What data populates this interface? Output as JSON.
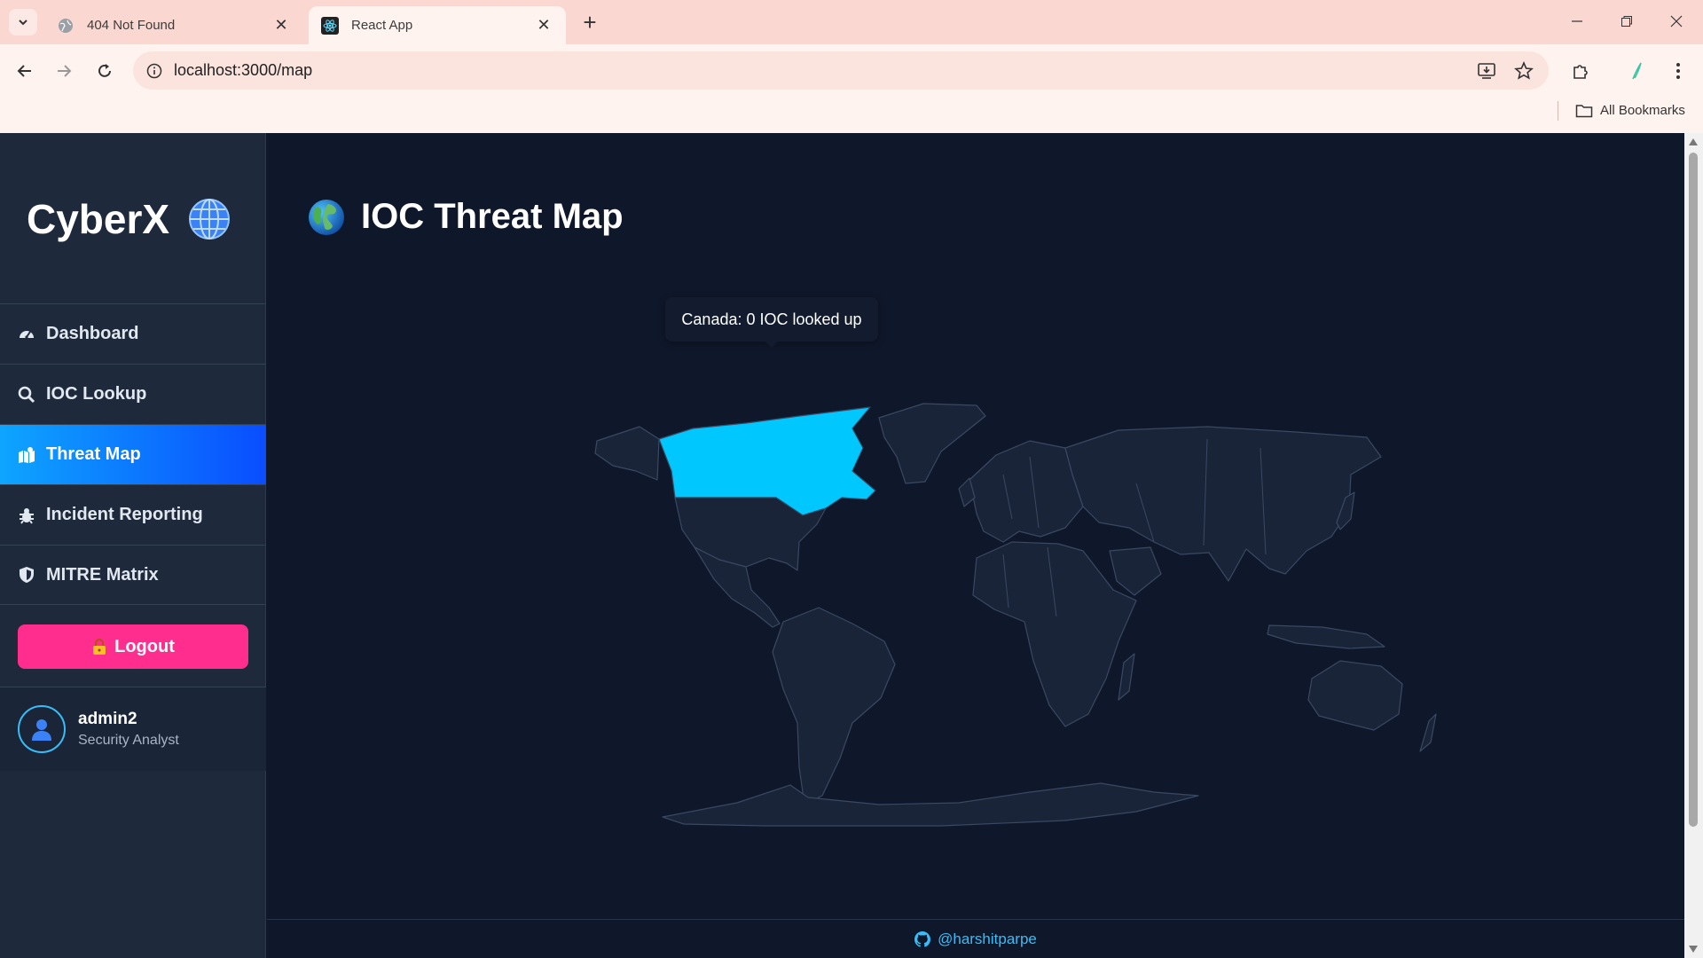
{
  "browser": {
    "tabs": [
      {
        "title": "404 Not Found",
        "active": false
      },
      {
        "title": "React App",
        "active": true
      }
    ],
    "url": "localhost:3000/map",
    "bookmarks_label": "All Bookmarks"
  },
  "sidebar": {
    "brand": "CyberX",
    "items": [
      {
        "label": "Dashboard",
        "icon": "dashboard-icon",
        "active": false
      },
      {
        "label": "IOC Lookup",
        "icon": "search-icon",
        "active": false
      },
      {
        "label": "Threat Map",
        "icon": "map-icon",
        "active": true
      },
      {
        "label": "Incident Reporting",
        "icon": "bug-icon",
        "active": false
      },
      {
        "label": "MITRE Matrix",
        "icon": "shield-icon",
        "active": false
      }
    ],
    "logout_label": "Logout",
    "user": {
      "name": "admin2",
      "role": "Security Analyst"
    }
  },
  "main": {
    "title": "IOC Threat Map",
    "tooltip": "Canada: 0 IOC looked up",
    "map": {
      "highlighted_country": "Canada",
      "highlight_color": "#00c8ff",
      "land_color": "#1a2438",
      "border_color": "#3a4863"
    }
  },
  "footer": {
    "handle": "@harshitparpe"
  },
  "colors": {
    "accent": "#0ea5ff",
    "logout": "#ff2d8e",
    "background": "#0f172a",
    "sidebar": "#1e293b"
  }
}
